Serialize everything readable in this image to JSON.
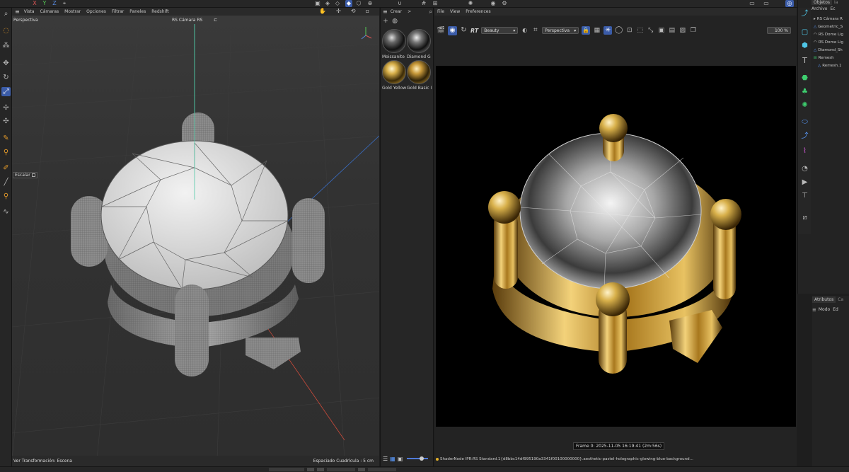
{
  "top_toolbar": {
    "icon_names": [
      "x-axis-icon",
      "y-axis-icon",
      "z-axis-icon",
      "coordinate-icon",
      "object-mode-icon",
      "point-mode-icon",
      "edge-mode-icon",
      "polygon-mode-icon",
      "snap-icon",
      "grid-icon",
      "render-region-icon",
      "render-view-icon",
      "render-settings-icon"
    ]
  },
  "viewport": {
    "menu": [
      "Vista",
      "Cámaras",
      "Mostrar",
      "Opciones",
      "Filtrar",
      "Paneles",
      "Redshift"
    ],
    "view_name": "Perspectiva",
    "camera_name": "RS Cámara RS",
    "tool_tooltip": "Escalar",
    "status_left": "Ver Transformación: Escena",
    "status_right": "Espaciado Cuadrícula : 5 cm"
  },
  "left_tools": [
    "zoom-icon",
    "select-icon",
    "move-icon",
    "rotate-icon",
    "scale-icon",
    "transform-icon",
    "polygon-pen-icon",
    "knife-icon",
    "brush-icon",
    "magnet-icon",
    "paint-icon",
    "sculpt-icon"
  ],
  "material_panel": {
    "menu": [
      "Crear",
      ">"
    ],
    "materials": [
      {
        "label": "Moissanite",
        "type": "glass"
      },
      {
        "label": "Diamond G",
        "type": "glass"
      },
      {
        "label": "Gold Yellow",
        "type": "gold"
      },
      {
        "label": "Gold Basic I",
        "type": "gold"
      }
    ]
  },
  "render_view": {
    "menu": [
      "File",
      "View",
      "Preferences"
    ],
    "rt_label": "RT",
    "aov_select": "Beauty",
    "camera_select": "Perspectiva",
    "zoom": "100 %",
    "frame_info": "Frame 0:  2025-11-05  16:19:41  (2m:56s)",
    "status_text": "ShaderNode IPR:RS Standard.1{d8bbc14df995190a3341f00100000000}.aesthetic-pastel-holographic-glowing-blue-background..."
  },
  "object_manager": {
    "tabs": [
      "Objetos",
      "Ia"
    ],
    "menu": [
      "Archivo",
      "Ec"
    ],
    "items": [
      {
        "label": "RS Cámara R",
        "depth": 0
      },
      {
        "label": "Geometric_S",
        "depth": 0
      },
      {
        "label": "RS Dome Lig",
        "depth": 0
      },
      {
        "label": "RS Dome Lig",
        "depth": 0
      },
      {
        "label": "Diamond_Sh",
        "depth": 0
      },
      {
        "label": "Remesh",
        "depth": 0
      },
      {
        "label": "Remesh.1",
        "depth": 1
      }
    ]
  },
  "attributes_panel": {
    "tabs": [
      "Atributos",
      "Ca"
    ],
    "menu": [
      "Modo",
      "Ed"
    ]
  },
  "right_tools": [
    "polygon-select-icon",
    "cube-icon",
    "text-icon",
    "generator-icon",
    "cloner-icon",
    "deformer-icon",
    "field-icon",
    "spline-icon",
    "effector-icon",
    "scene-icon",
    "camera-icon",
    "light-icon",
    "tag-icon"
  ],
  "colors": {
    "accent": "#3b5ca8",
    "gold": "#d8b04a",
    "viewport_bg": "#333333",
    "render_bg": "#000000"
  }
}
